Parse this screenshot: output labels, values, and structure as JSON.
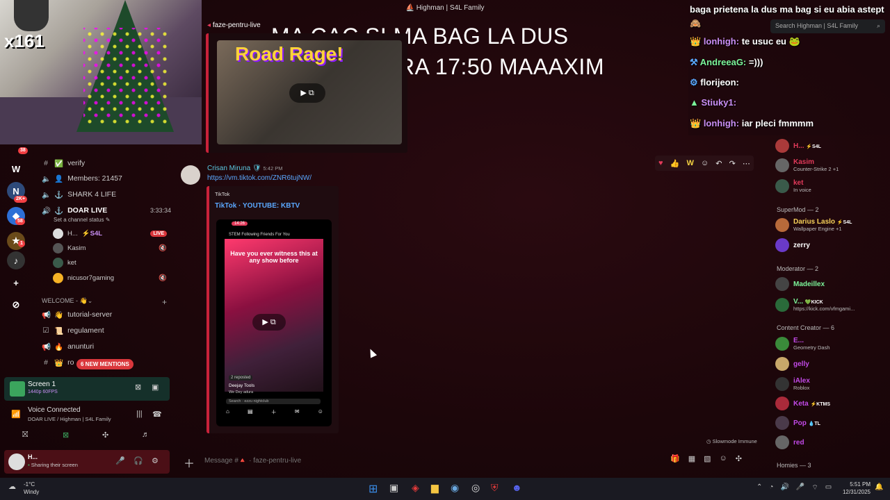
{
  "window": {
    "title": "Highman | S4L Family"
  },
  "webcam": {
    "counter": "x161"
  },
  "overlay": {
    "line1": "MA CAC SI MA BAG LA DUS",
    "line2": "REVIN LA ORA 17:50 MAAAXIM"
  },
  "servers": {
    "badge_top": "38",
    "badge_2k": "2K+",
    "badge_58": "58",
    "badge_1": "1"
  },
  "channels": {
    "current": "faze-pentru-live",
    "items": [
      {
        "icon": "#",
        "label": "verify"
      },
      {
        "icon": "🔈",
        "label": "Members: 21457"
      },
      {
        "icon": "🔈",
        "label": "SHARK 4 LIFE"
      },
      {
        "icon": "🔈",
        "label": "DOAR LIVE",
        "timer": "3:33:34"
      }
    ],
    "status_hint": "Set a channel status",
    "voice_users": [
      {
        "name": "H...",
        "tag": "⚡S4L",
        "live": "LIVE"
      },
      {
        "name": "Kasim"
      },
      {
        "name": "ket"
      },
      {
        "name": "nicusor7gaming"
      }
    ],
    "category": "WELCOME - 👋",
    "welcome": [
      {
        "icon": "👋",
        "label": "tutorial-server"
      },
      {
        "icon": "📜",
        "label": "regulament"
      },
      {
        "icon": "🔥",
        "label": "anunturi"
      },
      {
        "icon": "👑",
        "label": "ro"
      }
    ],
    "mentions": "6 NEW MENTIONS"
  },
  "screen": {
    "title": "Screen 1",
    "quality": "1440p 60FPS"
  },
  "voice": {
    "status": "Voice Connected",
    "location": "DOAR LIVE / Highman | S4L Family"
  },
  "user": {
    "name": "H...",
    "status": "Sharing their screen"
  },
  "chat": {
    "embed1_title": "Road Rage!",
    "author": "Crisan Miruna",
    "time": "5:42 PM",
    "link": "https://vm.tiktok.com/ZNR6tujNW/",
    "provider": "TikTok",
    "embed_title": "TikTok · YOUTUBE: KBTV",
    "video_caption": "Have you ever witness this at any show before",
    "video_time": "14:26",
    "tiktok_tabs": "STEM   Following   Friends   For You",
    "reposted": "2 reposted",
    "creator": "Deejay Tools",
    "sub": "We Dey adura",
    "search": "Search · ezzu nightclub",
    "slowmode": "Slowmode Immune",
    "placeholder": "Message #🔺 · faze-pentru-live"
  },
  "twitch": {
    "header": "baga prietena la dus ma bag si eu abia astept 🙈",
    "search": "Search Highman | S4L Family",
    "lines": [
      {
        "user": "lonhigh:",
        "text": "te usuc eu 🐸",
        "color": "#c98ff5"
      },
      {
        "user": "AndreeaG:",
        "text": "=)))",
        "color": "#7cf59a"
      },
      {
        "user": "florijeon:",
        "text": "",
        "color": "#ffffff"
      },
      {
        "user": "Stiuky1:",
        "text": "",
        "color": "#c98ff5"
      },
      {
        "user": "lonhigh:",
        "text": "iar pleci fmmmm",
        "color": "#c98ff5"
      }
    ]
  },
  "members": {
    "top": [
      {
        "name": "H...",
        "tag": "⚡S4L",
        "sub": "",
        "color": "#e23a5a"
      },
      {
        "name": "Kasim",
        "sub": "Counter-Strike 2 +1",
        "color": "#e23a5a"
      },
      {
        "name": "ket",
        "sub": "In voice",
        "color": "#e23a5a"
      }
    ],
    "supermod_title": "SuperMod — 2",
    "supermods": [
      {
        "name": "Darius Laslo",
        "tag": "⚡S4L",
        "sub": "Wallpaper Engine +1",
        "color": "#f7d25a"
      },
      {
        "name": "zerry",
        "sub": "",
        "color": "#f7d25a"
      }
    ],
    "moderator_title": "Moderator — 2",
    "moderators": [
      {
        "name": "Madeillex",
        "sub": "",
        "color": "#7cf59a"
      },
      {
        "name": "V...",
        "tag": "💚KICK",
        "sub": "https://kick.com/vfmgami...",
        "color": "#7cf59a"
      }
    ],
    "creator_title": "Content Creator — 6",
    "creators": [
      {
        "name": "E...",
        "sub": "Geometry Dash",
        "color": "#c24ae8"
      },
      {
        "name": "gelly",
        "sub": "",
        "color": "#c24ae8"
      },
      {
        "name": "iAlex",
        "sub": "Roblox",
        "color": "#c24ae8"
      },
      {
        "name": "Keta",
        "tag": "⚡KTMS",
        "sub": "",
        "color": "#c24ae8"
      },
      {
        "name": "Pop",
        "tag": "💧TL",
        "sub": "",
        "color": "#c24ae8"
      },
      {
        "name": "red",
        "sub": "",
        "color": "#c24ae8"
      }
    ],
    "homies_title": "Homies — 3"
  },
  "taskbar": {
    "weather": "-1°C",
    "weather_desc": "Windy",
    "time": "5:51 PM",
    "date": "12/31/2025"
  }
}
